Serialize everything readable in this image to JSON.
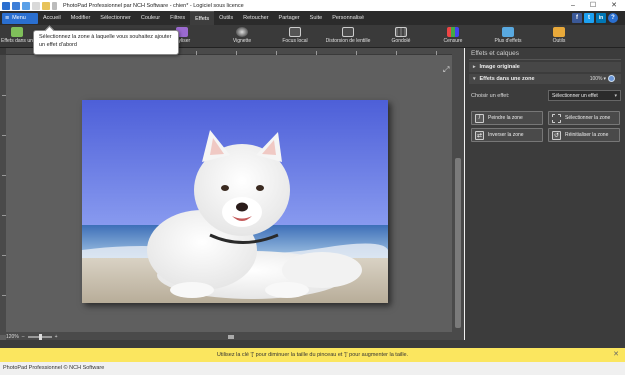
{
  "titlebar": {
    "title": "PhotoPad Professionnel par NCH Software - chien* - Logiciel sous licence",
    "minimize": "–",
    "maximize": "☐",
    "close": "✕"
  },
  "menu": {
    "menu_label": "Menu",
    "tabs": [
      "Accueil",
      "Modifier",
      "Sélectionner",
      "Couleur",
      "Filtres",
      "Effets",
      "Outils",
      "Retoucher",
      "Partager",
      "Suite",
      "Personnalisé"
    ],
    "active_tab": "Effets"
  },
  "social": {
    "facebook": "f",
    "twitter": "t",
    "linkedin": "in",
    "help": "?"
  },
  "ribbon": {
    "items": [
      {
        "label": "Effets dans une zone",
        "icon": "effects-zone-icon"
      },
      {
        "label": "Styliser",
        "icon": "stylize-icon"
      },
      {
        "label": "Vignette",
        "icon": "vignette-icon"
      },
      {
        "label": "Focus local",
        "icon": "local-focus-icon"
      },
      {
        "label": "Distorsion de lentille",
        "icon": "lens-distortion-icon"
      },
      {
        "label": "Gondolé",
        "icon": "ripple-icon"
      },
      {
        "label": "Censure",
        "icon": "censor-icon"
      },
      {
        "label": "Plus d'effets",
        "icon": "more-effects-icon"
      },
      {
        "label": "Outils",
        "icon": "tools-icon"
      }
    ]
  },
  "tooltip": {
    "text": "Sélectionnez la zone à laquelle vous souhaitez ajouter un effet d'abord"
  },
  "canvas": {
    "zoom": "120%",
    "zoom_minus": "–",
    "zoom_plus": "+",
    "ruler_left_marks": [
      "1",
      "2",
      "3",
      "4",
      "5",
      "6",
      "7"
    ],
    "ruler_top_marks": [
      "1",
      "2",
      "3",
      "4",
      "5",
      "6",
      "7",
      "8",
      "9",
      "10",
      "11",
      "12"
    ]
  },
  "panel": {
    "title": "Effets et calques",
    "sections": [
      {
        "label": "Image originale",
        "expanded": false
      },
      {
        "label": "Effets dans une zone",
        "expanded": true,
        "zoom": "100%"
      }
    ],
    "effect_label": "Choisir un effet:",
    "effect_select_value": "Sélectionner un effet",
    "buttons": {
      "paint_zone": "Peindre la zone",
      "select_zone": "Sélectionner la zone",
      "invert_zone": "Inverser la zone",
      "reset_zone": "Réinitialiser la zone"
    }
  },
  "hint": {
    "text": "Utilisez la clé '[' pour diminuer la taille du pinceau et ']' pour augmenter la taille.",
    "close": "✕"
  },
  "footer": {
    "text": "PhotoPad Professionnel © NCH Software"
  },
  "colors": {
    "menu_blue": "#2a6fd0",
    "hint_yellow": "#fbe65f",
    "panel_bg": "#3c3c3c",
    "canvas_bg": "#5f5f5f"
  }
}
